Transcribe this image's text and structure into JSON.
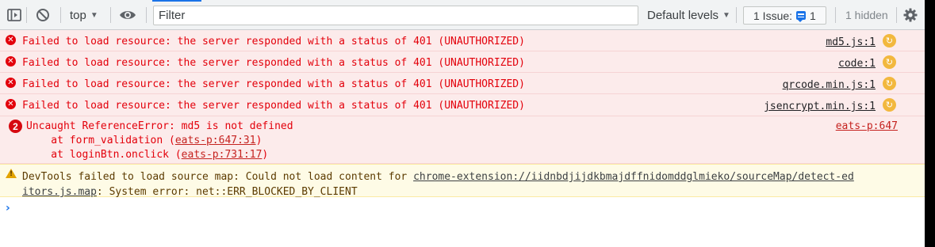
{
  "toolbar": {
    "context": "top",
    "filter_placeholder": "Filter",
    "levels_label": "Default levels",
    "issues_label": "1 Issue:",
    "issues_count": "1",
    "hidden_label": "1 hidden"
  },
  "errors": [
    {
      "text": "Failed to load resource: the server responded with a status of 401 (UNAUTHORIZED)",
      "source": "md5.js:1"
    },
    {
      "text": "Failed to load resource: the server responded with a status of 401 (UNAUTHORIZED)",
      "source": "code:1"
    },
    {
      "text": "Failed to load resource: the server responded with a status of 401 (UNAUTHORIZED)",
      "source": "qrcode.min.js:1"
    },
    {
      "text": "Failed to load resource: the server responded with a status of 401 (UNAUTHORIZED)",
      "source": "jsencrypt.min.js:1"
    }
  ],
  "uncaught": {
    "count": "2",
    "message": "Uncaught ReferenceError: md5 is not defined",
    "source": "eats-p:647",
    "stack": [
      {
        "prefix": "    at form_validation (",
        "link": "eats-p:647:31",
        "suffix": ")"
      },
      {
        "prefix": "    at loginBtn.onclick (",
        "link": "eats-p:731:17",
        "suffix": ")"
      }
    ]
  },
  "warning": {
    "prefix": "DevTools failed to load source map: Could not load content for ",
    "link1": "chrome-extension://iidnbdjijdkbmajdffnidomddglmieko/sourceMap/detect-ed",
    "link2": "itors.js.map",
    "suffix": ": System error: net::ERR_BLOCKED_BY_CLIENT"
  },
  "prompt": "›"
}
